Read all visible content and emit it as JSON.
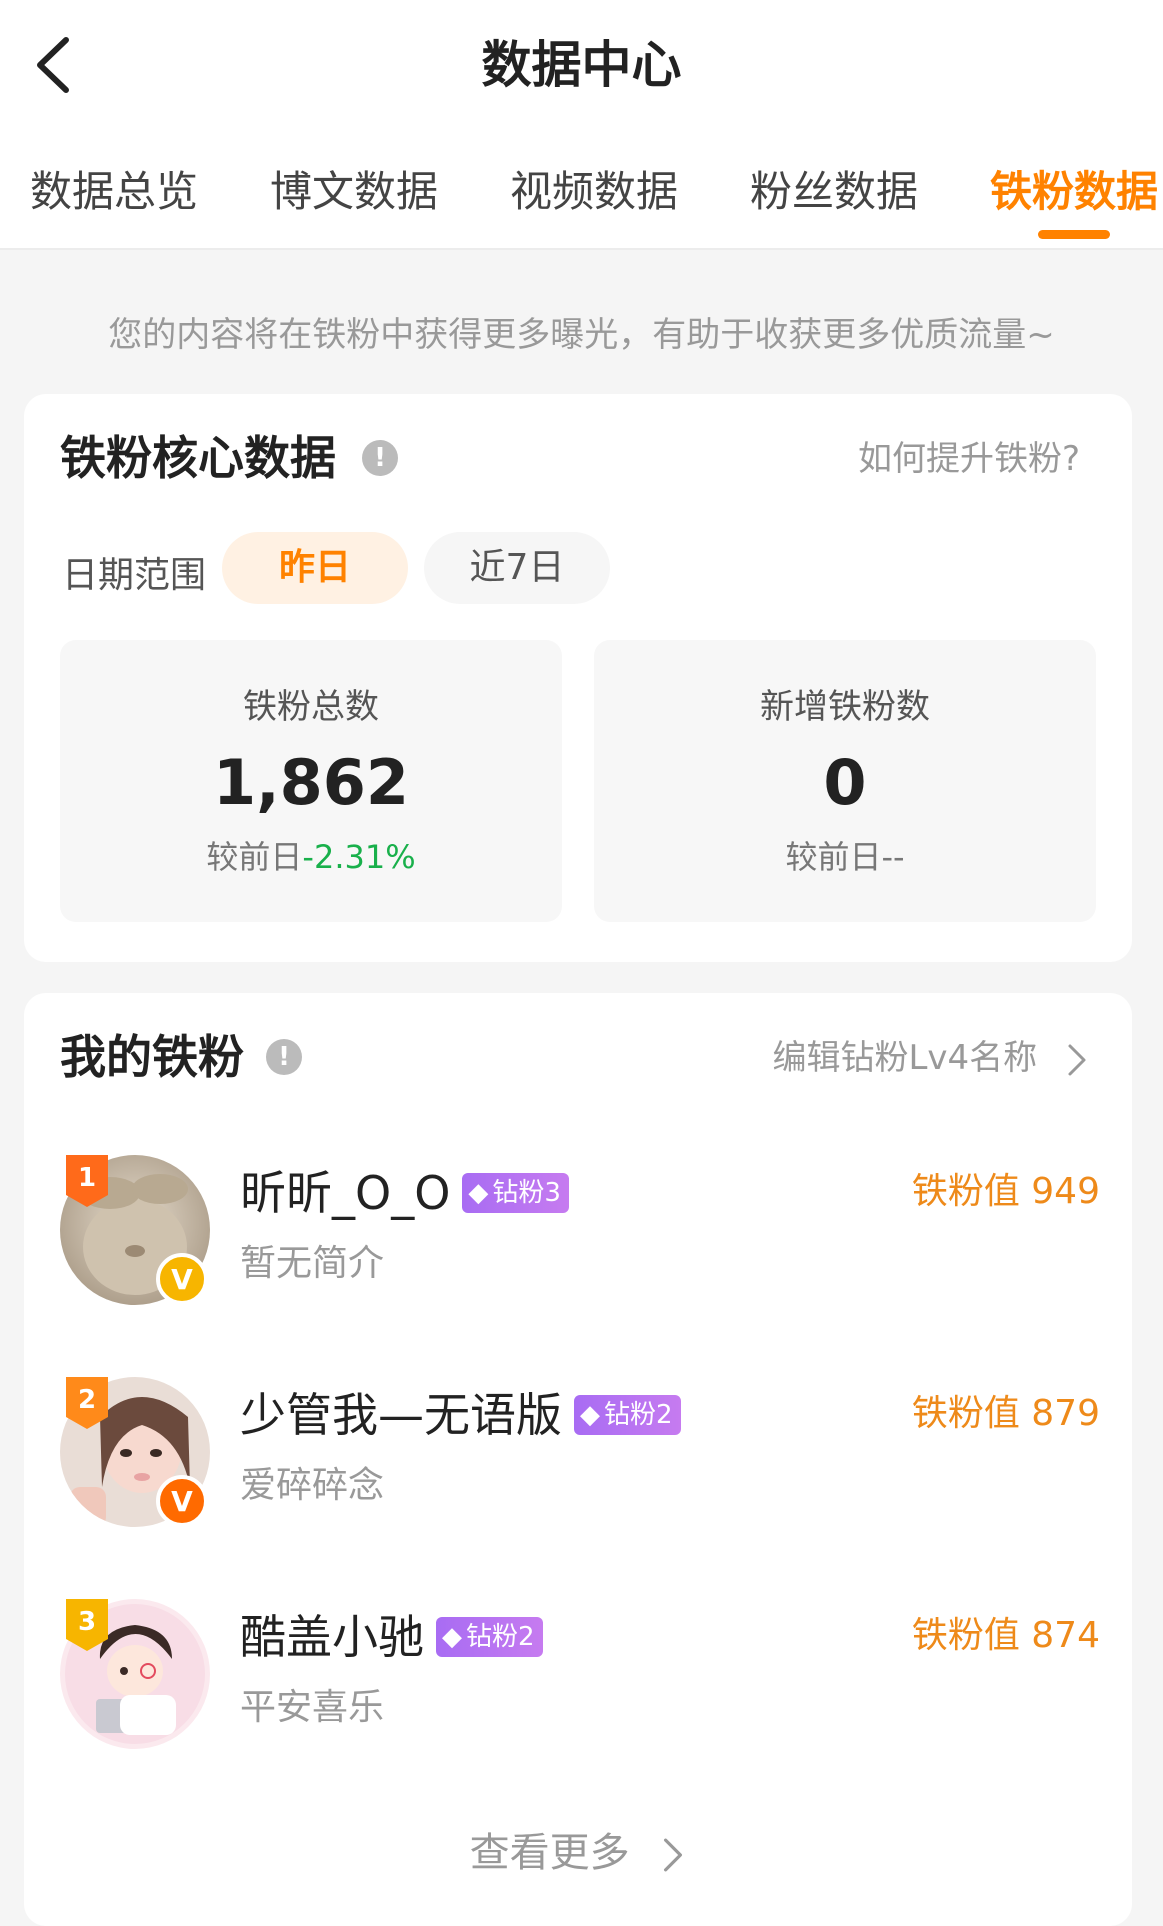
{
  "header": {
    "title": "数据中心",
    "tabs": [
      {
        "label": "数据总览",
        "active": false
      },
      {
        "label": "博文数据",
        "active": false
      },
      {
        "label": "视频数据",
        "active": false
      },
      {
        "label": "粉丝数据",
        "active": false
      },
      {
        "label": "铁粉数据",
        "active": true
      }
    ]
  },
  "notice": "您的内容将在铁粉中获得更多曝光，有助于收获更多优质流量~",
  "core": {
    "title": "铁粉核心数据",
    "link": "如何提升铁粉?",
    "date_label": "日期范围",
    "date_options": [
      "昨日",
      "近7日"
    ],
    "selected_date": "昨日",
    "stats": [
      {
        "label": "铁粉总数",
        "value": "1,862",
        "compare_prefix": "较前日",
        "compare_value": "-2.31%"
      },
      {
        "label": "新增铁粉数",
        "value": "0",
        "compare_prefix": "较前日",
        "compare_value": "--"
      }
    ]
  },
  "my_fans": {
    "title": "我的铁粉",
    "link": "编辑钻粉Lv4名称",
    "fans": [
      {
        "rank": "1",
        "name": "昕昕_O_O",
        "level": "钻粉3",
        "bio": "暂无简介",
        "score": "铁粉值 949",
        "verified": "V",
        "verified_color": "#f7b500"
      },
      {
        "rank": "2",
        "name": "少管我—无语版",
        "level": "钻粉2",
        "bio": "爱碎碎念",
        "score": "铁粉值 879",
        "verified": "V",
        "verified_color": "#ff6a00"
      },
      {
        "rank": "3",
        "name": "酷盖小驰",
        "level": "钻粉2",
        "bio": "平安喜乐",
        "score": "铁粉值 874",
        "verified": "",
        "verified_color": ""
      }
    ],
    "more": "查看更多"
  },
  "colors": {
    "accent": "#ff8200",
    "down": "#19b04b",
    "score": "#ee8a1a",
    "level_badge": "#b070f0"
  }
}
